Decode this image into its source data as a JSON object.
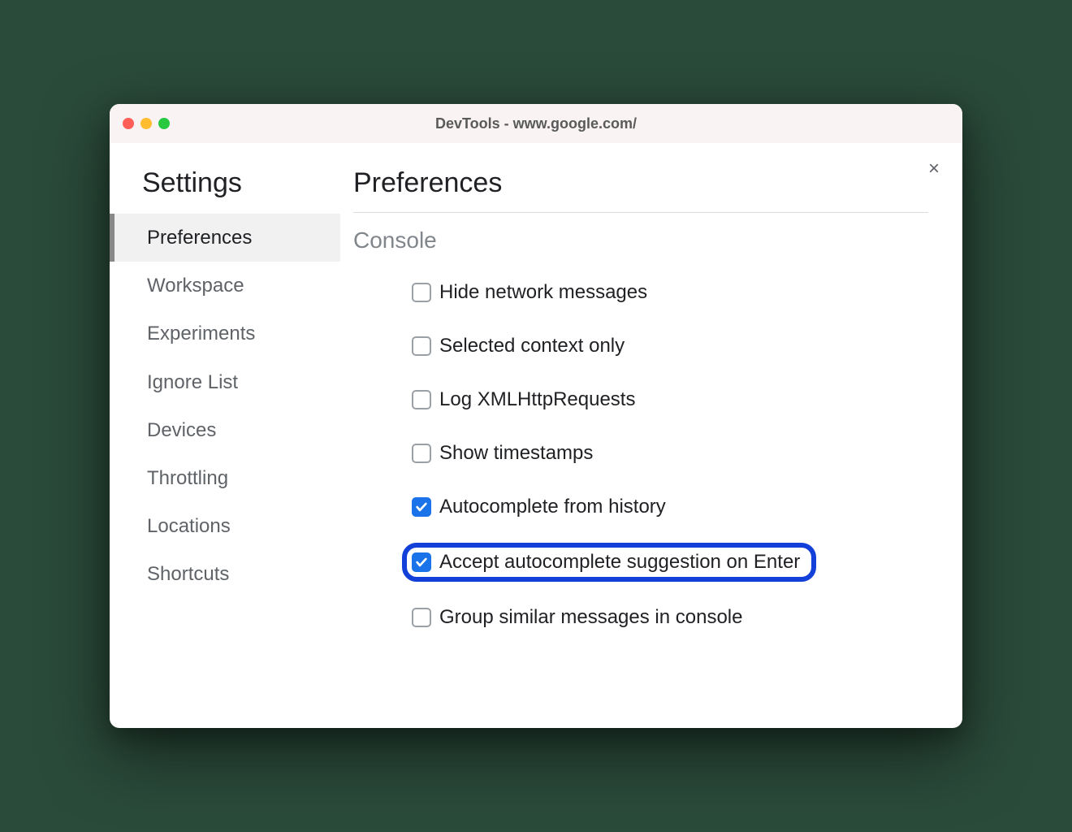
{
  "window": {
    "title": "DevTools - www.google.com/"
  },
  "sidebar": {
    "title": "Settings",
    "items": [
      {
        "label": "Preferences",
        "active": true
      },
      {
        "label": "Workspace",
        "active": false
      },
      {
        "label": "Experiments",
        "active": false
      },
      {
        "label": "Ignore List",
        "active": false
      },
      {
        "label": "Devices",
        "active": false
      },
      {
        "label": "Throttling",
        "active": false
      },
      {
        "label": "Locations",
        "active": false
      },
      {
        "label": "Shortcuts",
        "active": false
      }
    ]
  },
  "main": {
    "title": "Preferences",
    "section": "Console",
    "options": [
      {
        "label": "Hide network messages",
        "checked": false,
        "highlighted": false
      },
      {
        "label": "Selected context only",
        "checked": false,
        "highlighted": false
      },
      {
        "label": "Log XMLHttpRequests",
        "checked": false,
        "highlighted": false
      },
      {
        "label": "Show timestamps",
        "checked": false,
        "highlighted": false
      },
      {
        "label": "Autocomplete from history",
        "checked": true,
        "highlighted": false
      },
      {
        "label": "Accept autocomplete suggestion on Enter",
        "checked": true,
        "highlighted": true
      },
      {
        "label": "Group similar messages in console",
        "checked": false,
        "highlighted": false
      }
    ]
  },
  "close_label": "×"
}
